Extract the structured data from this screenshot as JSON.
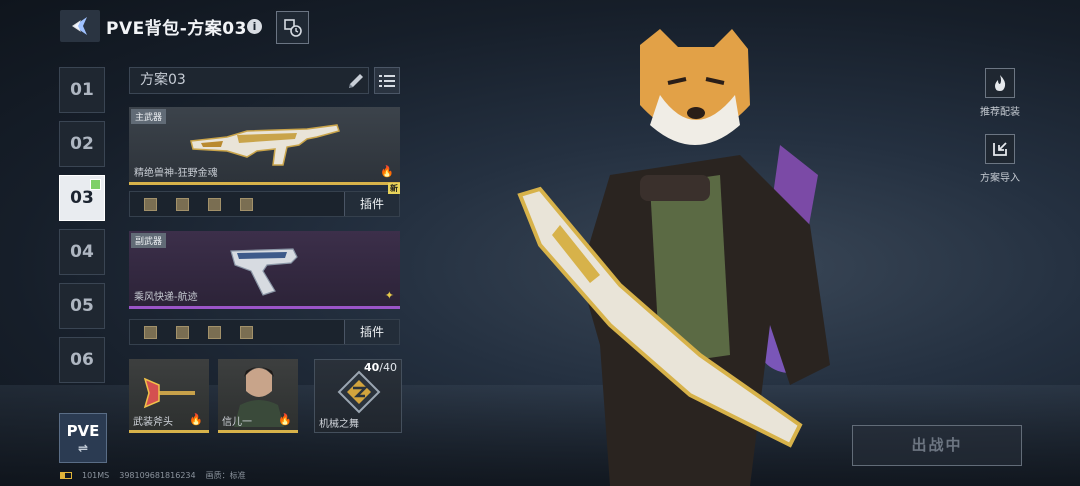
{
  "header": {
    "title": "PVE背包-方案03",
    "info_label": "i",
    "back_icon": "back-arrow-icon",
    "history_icon": "history-icon"
  },
  "slots": [
    {
      "label": "01",
      "active": false
    },
    {
      "label": "02",
      "active": false
    },
    {
      "label": "03",
      "active": true
    },
    {
      "label": "04",
      "active": false
    },
    {
      "label": "05",
      "active": false
    },
    {
      "label": "06",
      "active": false
    }
  ],
  "mode_button": {
    "label": "PVE",
    "swap_symbol": "⇌"
  },
  "plan": {
    "name": "方案03",
    "edit_icon": "pencil-icon",
    "list_icon": "list-icon"
  },
  "primary_weapon": {
    "tag": "主武器",
    "name": "精绝兽神-狂野金魂",
    "plugin_label": "插件",
    "new_badge": "新",
    "plugin_slots": 4
  },
  "secondary_weapon": {
    "tag": "副武器",
    "name": "乘风快递-航迹",
    "plugin_label": "插件",
    "plugin_slots": 4
  },
  "items": [
    {
      "name": "武装斧头"
    },
    {
      "name": "信儿一"
    },
    {
      "name": "机械之舞",
      "count_current": "40",
      "count_sep": "/",
      "count_max": "40"
    }
  ],
  "right_panel": {
    "recommend_label": "推荐配装",
    "recommend_icon": "flame-icon",
    "import_label": "方案导入",
    "import_icon": "import-icon",
    "battle_label": "出战中"
  },
  "status_bar": {
    "ping": "101MS",
    "uid": "398109681816234",
    "quality": "画质：标准"
  },
  "colors": {
    "gold": "#d7b24a",
    "purple": "#9b55c8",
    "active_mark": "#7fd067"
  }
}
